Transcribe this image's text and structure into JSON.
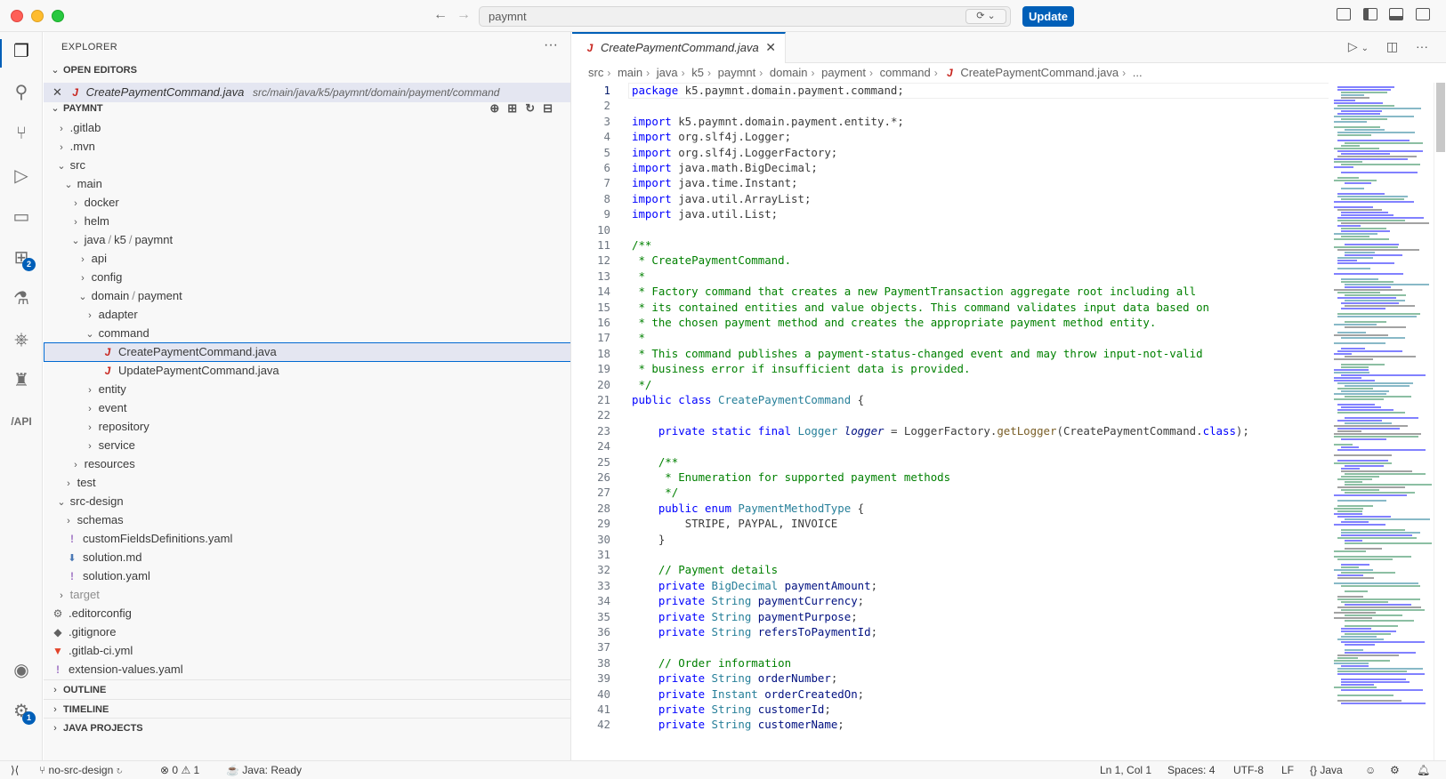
{
  "titlebar": {
    "search_text": "paymnt",
    "update_label": "Update"
  },
  "activity": {
    "extensions_badge": "2",
    "settings_badge": "1"
  },
  "sidebar": {
    "title": "EXPLORER",
    "more_actions": "···",
    "open_editors_label": "OPEN EDITORS",
    "open_editor": {
      "file": "CreatePaymentCommand.java",
      "path": "src/main/java/k5/paymnt/domain/payment/command"
    },
    "project_label": "PAYMNT",
    "tree": [
      {
        "label": ".gitlab"
      },
      {
        "label": ".mvn"
      },
      {
        "label": "src"
      },
      {
        "label": "main"
      },
      {
        "label": "docker"
      },
      {
        "label": "helm"
      },
      {
        "label": "java / k5 / paymnt",
        "parts": [
          "java",
          "k5",
          "paymnt"
        ]
      },
      {
        "label": "api"
      },
      {
        "label": "config"
      },
      {
        "label": "domain / payment",
        "parts": [
          "domain",
          "payment"
        ]
      },
      {
        "label": "adapter"
      },
      {
        "label": "command"
      },
      {
        "label": "CreatePaymentCommand.java"
      },
      {
        "label": "UpdatePaymentCommand.java"
      },
      {
        "label": "entity"
      },
      {
        "label": "event"
      },
      {
        "label": "repository"
      },
      {
        "label": "service"
      },
      {
        "label": "resources"
      },
      {
        "label": "test"
      },
      {
        "label": "src-design"
      },
      {
        "label": "schemas"
      },
      {
        "label": "customFieldsDefinitions.yaml"
      },
      {
        "label": "solution.md"
      },
      {
        "label": "solution.yaml"
      },
      {
        "label": "target"
      },
      {
        "label": ".editorconfig"
      },
      {
        "label": ".gitignore"
      },
      {
        "label": ".gitlab-ci.yml"
      },
      {
        "label": "extension-values.yaml"
      }
    ],
    "outline_label": "OUTLINE",
    "timeline_label": "TIMELINE",
    "java_projects_label": "JAVA PROJECTS"
  },
  "editor": {
    "tab_label": "CreatePaymentCommand.java",
    "breadcrumb": [
      "src",
      "main",
      "java",
      "k5",
      "paymnt",
      "domain",
      "payment",
      "command",
      "CreatePaymentCommand.java",
      "..."
    ],
    "line_numbers": [
      "1",
      "2",
      "3",
      "4",
      "5",
      "6",
      "7",
      "8",
      "9",
      "10",
      "11",
      "12",
      "13",
      "14",
      "15",
      "16",
      "17",
      "18",
      "19",
      "20",
      "21",
      "22",
      "23",
      "24",
      "25",
      "26",
      "27",
      "28",
      "29",
      "30",
      "31",
      "32",
      "33",
      "34",
      "35",
      "36",
      "37",
      "38",
      "39",
      "40",
      "41",
      "42"
    ],
    "code": {
      "l1_kw": "package",
      "l1_rest": " k5.paymnt.domain.payment.command;",
      "l3_kw": "import",
      "l3_rest": " k5.paymnt.domain.payment.entity.*;",
      "l4_kw": "import",
      "l4_rest": " org.slf4j.Logger;",
      "l5_kw": "import",
      "l5_rest": " org.slf4j.LoggerFactory;",
      "l6_kw": "import",
      "l6_rest": " java.math.BigDecimal;",
      "l7_kw": "import",
      "l7_rest": " java.time.Instant;",
      "l8_kw": "import",
      "l8_rest": " java.util.ArrayList;",
      "l9_kw": "import",
      "l9_rest": " java.util.List;",
      "l11": "/**",
      "l12": " * CreatePaymentCommand.",
      "l13": " *",
      "l14": " * Factory command that creates a new PaymentTransaction aggregate root including all",
      "l15": " * its contained entities and value objects. This command validates input data based on",
      "l16": " * the chosen payment method and creates the appropriate payment method entity.",
      "l17": " *",
      "l18": " * This command publishes a payment-status-changed event and may throw input-not-valid",
      "l19": " * business error if insufficient data is provided.",
      "l20": " */",
      "l21_kw": "public class",
      "l21_ty": "CreatePaymentCommand",
      "l21_rest": " {",
      "l23_kw": "private static final",
      "l23_ty": "Logger",
      "l23_var": "logger",
      "l23_eq": " = LoggerFactory.",
      "l23_fn": "getLogger",
      "l23_arg": "(CreatePaymentCommand.",
      "l23_cls": "class",
      "l23_end": ");",
      "l25": "/**",
      "l26": " * Enumeration for supported payment methods",
      "l27": " */",
      "l28_kw": "public enum",
      "l28_ty": "PaymentMethodType",
      "l28_rest": " {",
      "l29": "STRIPE, PAYPAL, INVOICE",
      "l30": "}",
      "l32": "// Payment details",
      "l33_kw": "private",
      "l33_ty": "BigDecimal",
      "l33_var": "paymentAmount",
      "l33_end": ";",
      "l34_kw": "private",
      "l34_ty": "String",
      "l34_var": "paymentCurrency",
      "l34_end": ";",
      "l35_kw": "private",
      "l35_ty": "String",
      "l35_var": "paymentPurpose",
      "l35_end": ";",
      "l36_kw": "private",
      "l36_ty": "String",
      "l36_var": "refersToPaymentId",
      "l36_end": ";",
      "l38": "// Order information",
      "l39_kw": "private",
      "l39_ty": "String",
      "l39_var": "orderNumber",
      "l39_end": ";",
      "l40_kw": "private",
      "l40_ty": "Instant",
      "l40_var": "orderCreatedOn",
      "l40_end": ";",
      "l41_kw": "private",
      "l41_ty": "String",
      "l41_var": "customerId",
      "l41_end": ";",
      "l42_kw": "private",
      "l42_ty": "String",
      "l42_var": "customerName",
      "l42_end": ";"
    }
  },
  "statusbar": {
    "branch": "no-src-design",
    "errors": "0",
    "warnings": "1",
    "java_status": "Java: Ready",
    "position": "Ln 1, Col 1",
    "spaces": "Spaces: 4",
    "encoding": "UTF-8",
    "eol": "LF",
    "language": "Java"
  },
  "colors": {
    "accent": "#005fb8",
    "keyword": "#0000ff",
    "type": "#267f99",
    "comment": "#008000",
    "function": "#795e26",
    "java_icon": "#c7231c"
  }
}
